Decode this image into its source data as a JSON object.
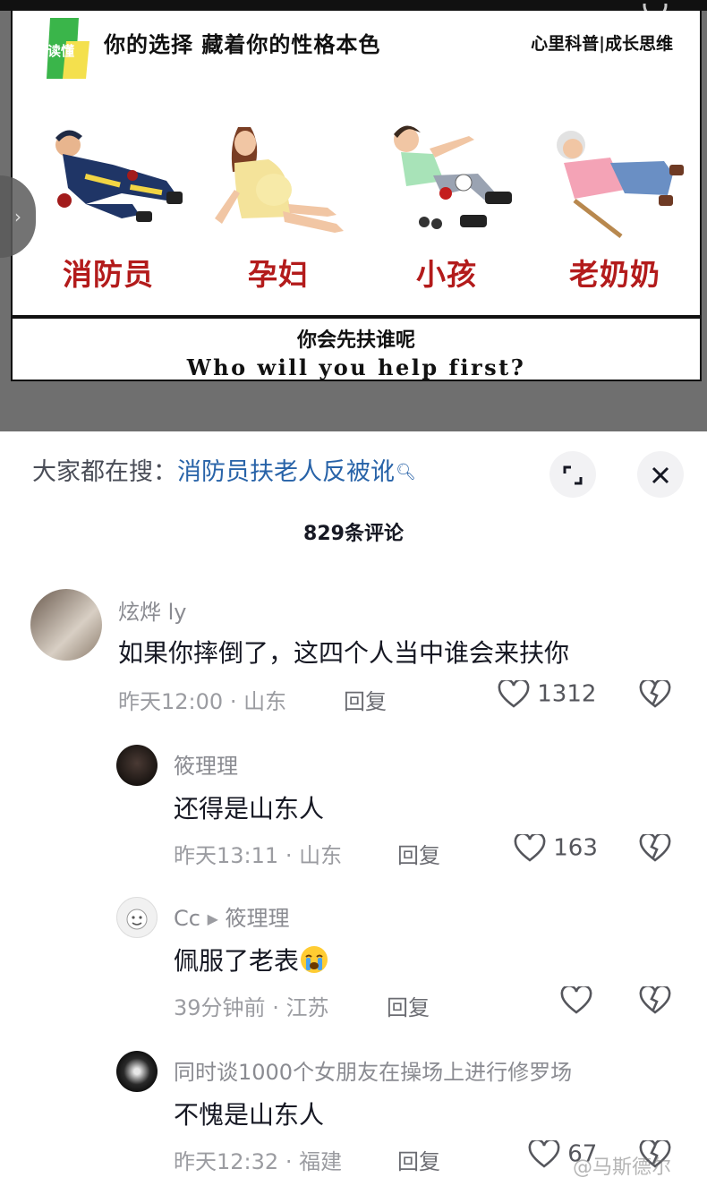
{
  "poster": {
    "logo_text": "读懂",
    "title": "你的选择 藏着你的性格本色",
    "tag": "心里科普|成长思维",
    "figures": [
      {
        "label": "消防员"
      },
      {
        "label": "孕妇"
      },
      {
        "label": "小孩"
      },
      {
        "label": "老奶奶"
      }
    ],
    "question_cn": "你会先扶谁呢",
    "question_en": "Who will you help first?"
  },
  "sheet": {
    "search_prefix": "大家都在搜：",
    "search_term": "消防员扶老人反被讹",
    "search_icon": "search-icon",
    "comment_count": "829条评论"
  },
  "comments": [
    {
      "name": "炫烨 ly",
      "text": "如果你摔倒了，这四个人当中谁会来扶你",
      "time": "昨天12:00",
      "location": "山东",
      "reply": "回复",
      "likes": "1312"
    },
    {
      "name": "筱理理",
      "text": "还得是山东人",
      "time": "昨天13:11",
      "location": "山东",
      "reply": "回复",
      "likes": "163"
    },
    {
      "name": "Cc",
      "reply_to": "筱理理",
      "text": "佩服了老表",
      "time": "39分钟前",
      "location": "江苏",
      "reply": "回复",
      "likes": ""
    },
    {
      "name": "同时谈1000个女朋友在操场上进行修罗场",
      "text": "不愧是山东人",
      "time": "昨天12:32",
      "location": "福建",
      "reply": "回复",
      "likes": "67"
    }
  ],
  "separator": "·",
  "watermark": "@马斯德尔",
  "colors": {
    "accent_red": "#b31b1b",
    "link_blue": "#2863a8",
    "logo_green": "#3ab54a",
    "logo_yellow": "#f4e04d"
  }
}
